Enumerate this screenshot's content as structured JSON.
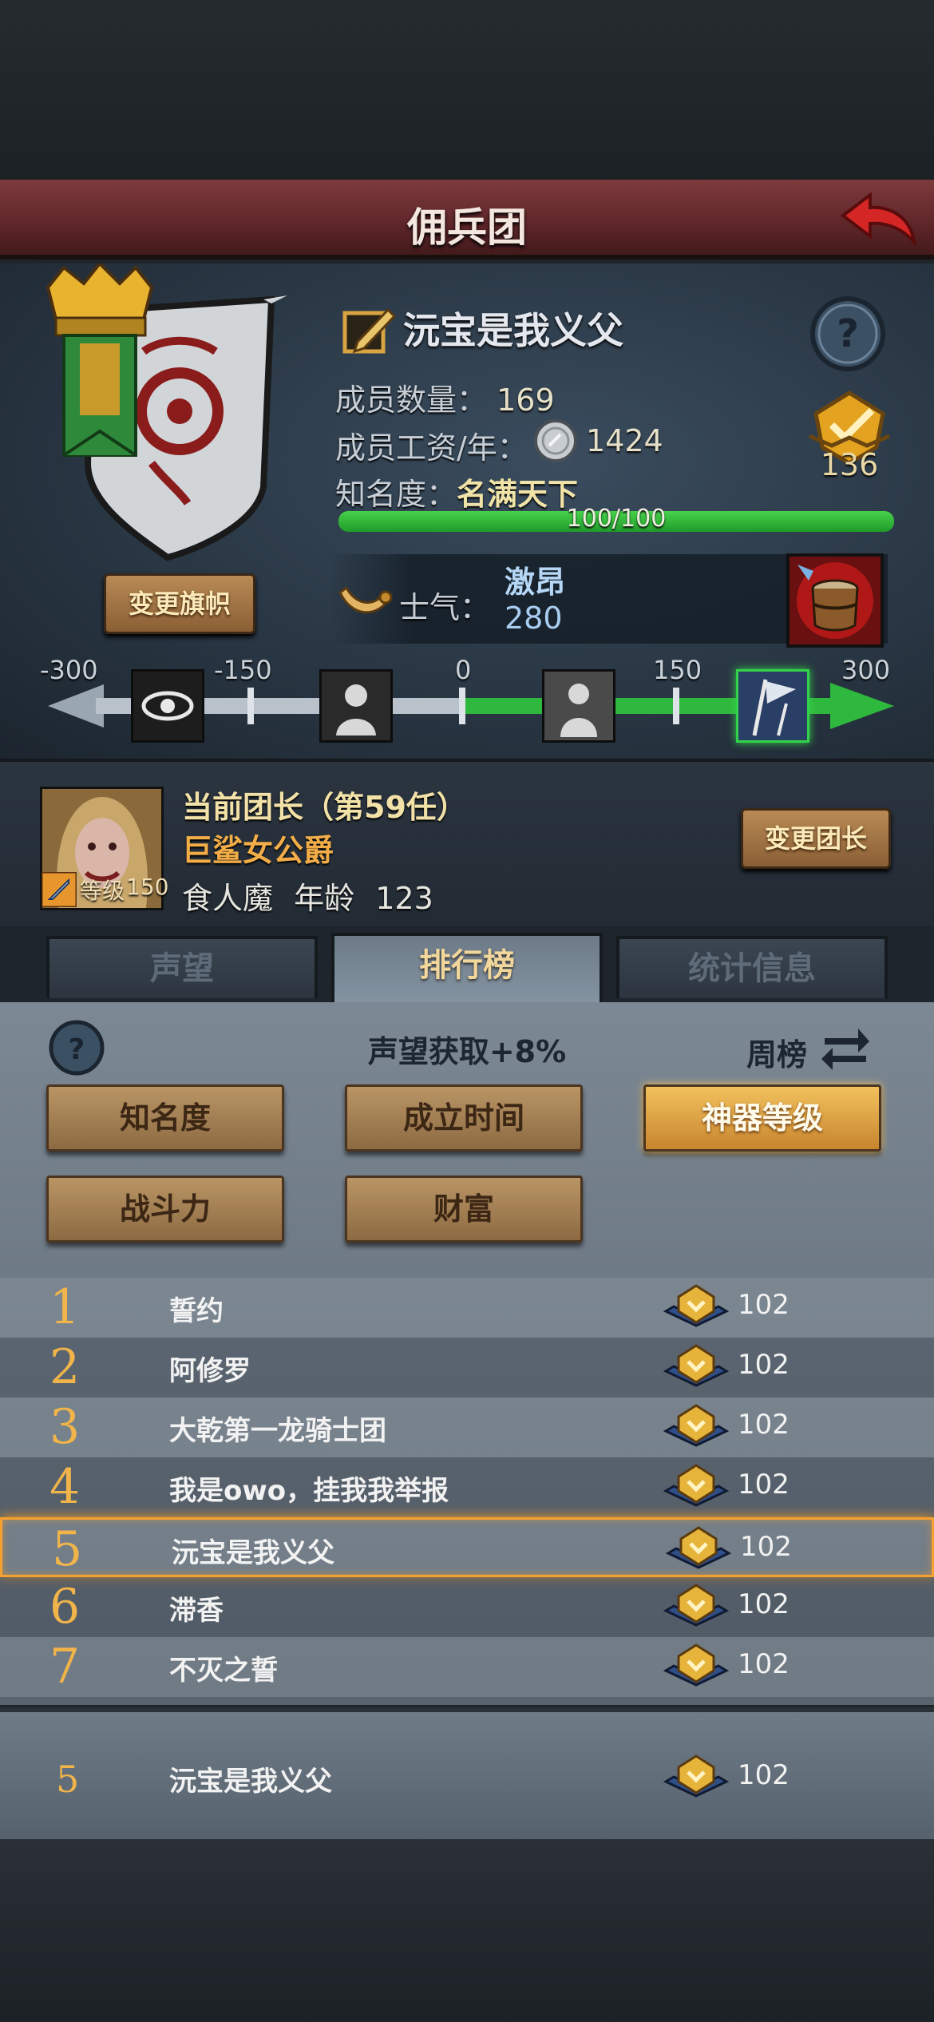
{
  "header": {
    "title": "佣兵团"
  },
  "guild": {
    "name": "沅宝是我义父",
    "members_label": "成员数量：",
    "members_value": "169",
    "salary_label": "成员工资/年：",
    "salary_value": "1424",
    "fame_label": "知名度：",
    "fame_value": "名满天下",
    "fame_progress": "100/100",
    "fame_fraction": 1.0,
    "rank_value": "136",
    "change_flag_label": "变更旗帜"
  },
  "morale": {
    "label": "士气：",
    "state": "激昂",
    "value": "280",
    "slider_ticks": [
      "-300",
      "-150",
      "0",
      "150",
      "300"
    ]
  },
  "leader": {
    "title": "当前团长（第59任）",
    "name": "巨鲨女公爵",
    "race": "食人魔",
    "age_label": "年龄",
    "age_value": "123",
    "level_label": "等级",
    "level_value": "150",
    "change_leader_label": "变更团长"
  },
  "tabs": [
    {
      "label": "声望"
    },
    {
      "label": "排行榜"
    },
    {
      "label": "统计信息"
    }
  ],
  "ranking": {
    "bonus_text": "声望获取+8%",
    "period_label": "周榜",
    "filters": [
      {
        "label": "知名度"
      },
      {
        "label": "成立时间"
      },
      {
        "label": "神器等级"
      },
      {
        "label": "战斗力"
      },
      {
        "label": "财富"
      }
    ],
    "rows": [
      {
        "rank": "1",
        "name": "誓约",
        "value": "102"
      },
      {
        "rank": "2",
        "name": "阿修罗",
        "value": "102"
      },
      {
        "rank": "3",
        "name": "大乾第一龙骑士团",
        "value": "102"
      },
      {
        "rank": "4",
        "name": "我是owo，挂我我举报",
        "value": "102"
      },
      {
        "rank": "5",
        "name": "沅宝是我义父",
        "value": "102"
      },
      {
        "rank": "6",
        "name": "滞香",
        "value": "102"
      },
      {
        "rank": "7",
        "name": "不灭之誓",
        "value": "102"
      }
    ],
    "my_row": {
      "rank": "5",
      "name": "沅宝是我义父",
      "value": "102"
    }
  },
  "colors": {
    "banner": "#6b2e31",
    "accent_gold": "#f2c15d",
    "morale_green": "#34d24a",
    "rank_number": "#f0b44a"
  }
}
